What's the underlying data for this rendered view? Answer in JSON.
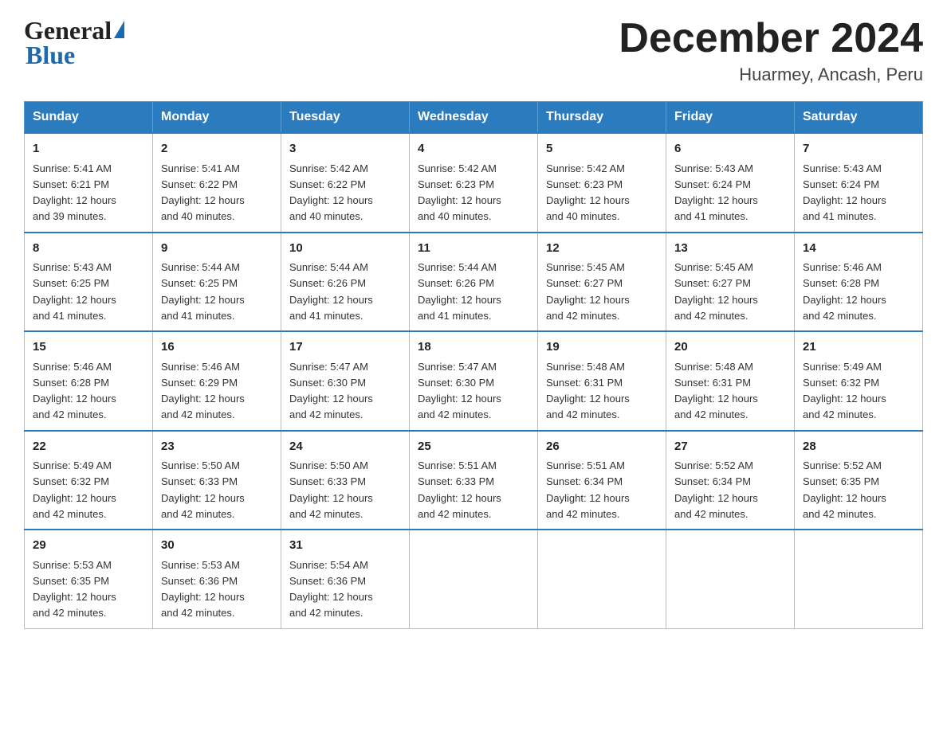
{
  "header": {
    "logo_general": "General",
    "logo_blue": "Blue",
    "month_title": "December 2024",
    "subtitle": "Huarmey, Ancash, Peru"
  },
  "days_of_week": [
    "Sunday",
    "Monday",
    "Tuesday",
    "Wednesday",
    "Thursday",
    "Friday",
    "Saturday"
  ],
  "weeks": [
    [
      {
        "day": "1",
        "sunrise": "5:41 AM",
        "sunset": "6:21 PM",
        "daylight": "12 hours and 39 minutes."
      },
      {
        "day": "2",
        "sunrise": "5:41 AM",
        "sunset": "6:22 PM",
        "daylight": "12 hours and 40 minutes."
      },
      {
        "day": "3",
        "sunrise": "5:42 AM",
        "sunset": "6:22 PM",
        "daylight": "12 hours and 40 minutes."
      },
      {
        "day": "4",
        "sunrise": "5:42 AM",
        "sunset": "6:23 PM",
        "daylight": "12 hours and 40 minutes."
      },
      {
        "day": "5",
        "sunrise": "5:42 AM",
        "sunset": "6:23 PM",
        "daylight": "12 hours and 40 minutes."
      },
      {
        "day": "6",
        "sunrise": "5:43 AM",
        "sunset": "6:24 PM",
        "daylight": "12 hours and 41 minutes."
      },
      {
        "day": "7",
        "sunrise": "5:43 AM",
        "sunset": "6:24 PM",
        "daylight": "12 hours and 41 minutes."
      }
    ],
    [
      {
        "day": "8",
        "sunrise": "5:43 AM",
        "sunset": "6:25 PM",
        "daylight": "12 hours and 41 minutes."
      },
      {
        "day": "9",
        "sunrise": "5:44 AM",
        "sunset": "6:25 PM",
        "daylight": "12 hours and 41 minutes."
      },
      {
        "day": "10",
        "sunrise": "5:44 AM",
        "sunset": "6:26 PM",
        "daylight": "12 hours and 41 minutes."
      },
      {
        "day": "11",
        "sunrise": "5:44 AM",
        "sunset": "6:26 PM",
        "daylight": "12 hours and 41 minutes."
      },
      {
        "day": "12",
        "sunrise": "5:45 AM",
        "sunset": "6:27 PM",
        "daylight": "12 hours and 42 minutes."
      },
      {
        "day": "13",
        "sunrise": "5:45 AM",
        "sunset": "6:27 PM",
        "daylight": "12 hours and 42 minutes."
      },
      {
        "day": "14",
        "sunrise": "5:46 AM",
        "sunset": "6:28 PM",
        "daylight": "12 hours and 42 minutes."
      }
    ],
    [
      {
        "day": "15",
        "sunrise": "5:46 AM",
        "sunset": "6:28 PM",
        "daylight": "12 hours and 42 minutes."
      },
      {
        "day": "16",
        "sunrise": "5:46 AM",
        "sunset": "6:29 PM",
        "daylight": "12 hours and 42 minutes."
      },
      {
        "day": "17",
        "sunrise": "5:47 AM",
        "sunset": "6:30 PM",
        "daylight": "12 hours and 42 minutes."
      },
      {
        "day": "18",
        "sunrise": "5:47 AM",
        "sunset": "6:30 PM",
        "daylight": "12 hours and 42 minutes."
      },
      {
        "day": "19",
        "sunrise": "5:48 AM",
        "sunset": "6:31 PM",
        "daylight": "12 hours and 42 minutes."
      },
      {
        "day": "20",
        "sunrise": "5:48 AM",
        "sunset": "6:31 PM",
        "daylight": "12 hours and 42 minutes."
      },
      {
        "day": "21",
        "sunrise": "5:49 AM",
        "sunset": "6:32 PM",
        "daylight": "12 hours and 42 minutes."
      }
    ],
    [
      {
        "day": "22",
        "sunrise": "5:49 AM",
        "sunset": "6:32 PM",
        "daylight": "12 hours and 42 minutes."
      },
      {
        "day": "23",
        "sunrise": "5:50 AM",
        "sunset": "6:33 PM",
        "daylight": "12 hours and 42 minutes."
      },
      {
        "day": "24",
        "sunrise": "5:50 AM",
        "sunset": "6:33 PM",
        "daylight": "12 hours and 42 minutes."
      },
      {
        "day": "25",
        "sunrise": "5:51 AM",
        "sunset": "6:33 PM",
        "daylight": "12 hours and 42 minutes."
      },
      {
        "day": "26",
        "sunrise": "5:51 AM",
        "sunset": "6:34 PM",
        "daylight": "12 hours and 42 minutes."
      },
      {
        "day": "27",
        "sunrise": "5:52 AM",
        "sunset": "6:34 PM",
        "daylight": "12 hours and 42 minutes."
      },
      {
        "day": "28",
        "sunrise": "5:52 AM",
        "sunset": "6:35 PM",
        "daylight": "12 hours and 42 minutes."
      }
    ],
    [
      {
        "day": "29",
        "sunrise": "5:53 AM",
        "sunset": "6:35 PM",
        "daylight": "12 hours and 42 minutes."
      },
      {
        "day": "30",
        "sunrise": "5:53 AM",
        "sunset": "6:36 PM",
        "daylight": "12 hours and 42 minutes."
      },
      {
        "day": "31",
        "sunrise": "5:54 AM",
        "sunset": "6:36 PM",
        "daylight": "12 hours and 42 minutes."
      },
      null,
      null,
      null,
      null
    ]
  ],
  "labels": {
    "sunrise": "Sunrise:",
    "sunset": "Sunset:",
    "daylight": "Daylight:"
  }
}
